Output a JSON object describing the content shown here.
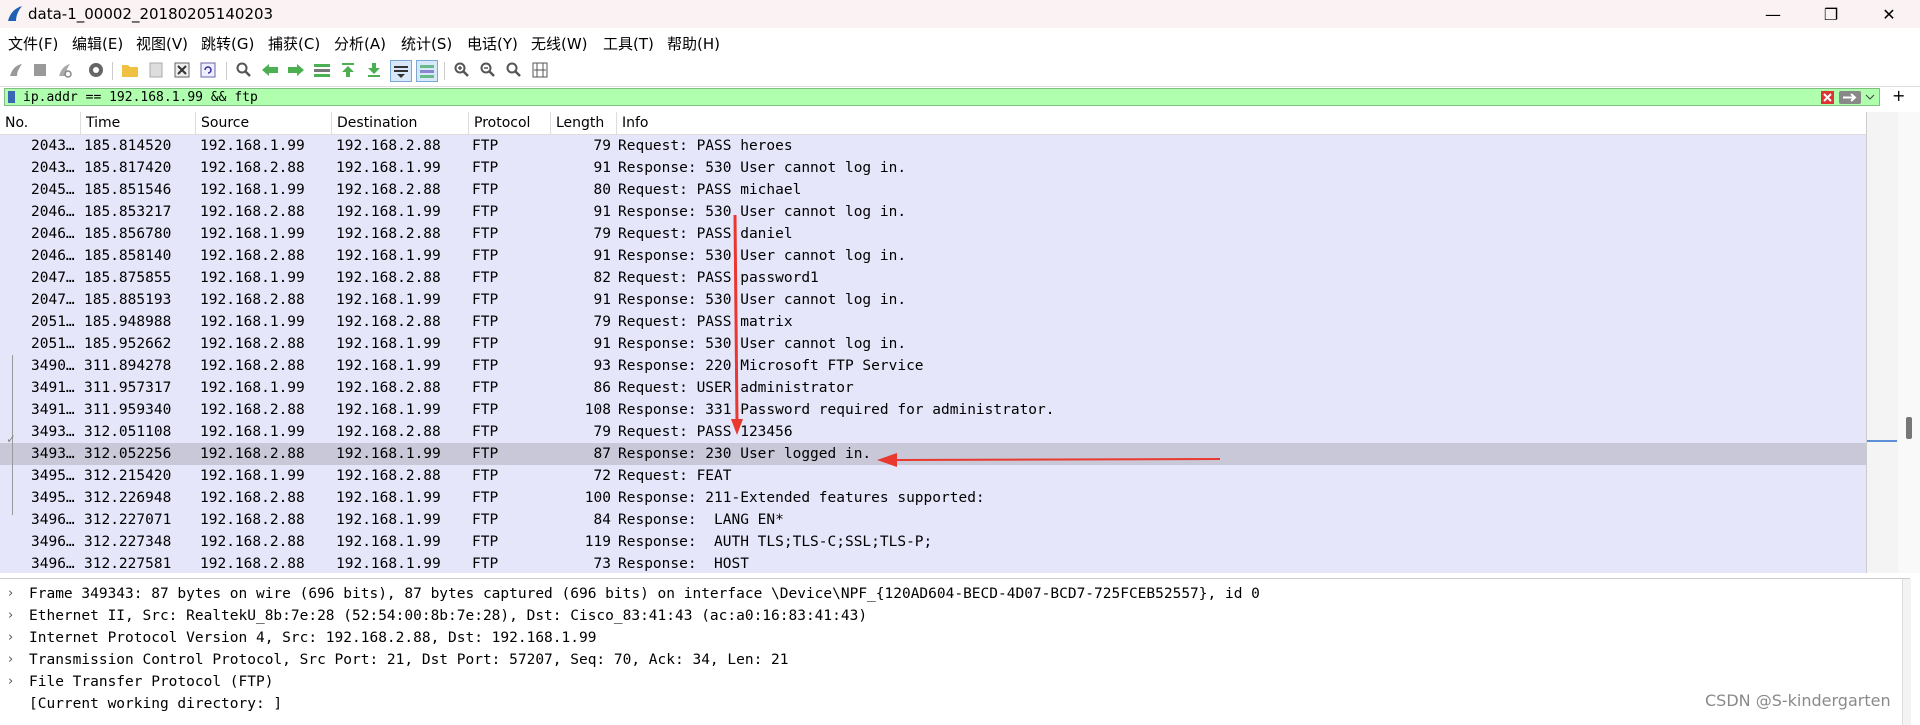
{
  "window": {
    "title": "data-1_00002_20180205140203",
    "minimize": "—",
    "maximize": "❐",
    "close": "✕"
  },
  "menu": [
    "文件(F)",
    "编辑(E)",
    "视图(V)",
    "跳转(G)",
    "捕获(C)",
    "分析(A)",
    "统计(S)",
    "电话(Y)",
    "无线(W)",
    "工具(T)",
    "帮助(H)"
  ],
  "filter": {
    "value": "ip.addr == 192.168.1.99 && ftp",
    "add_label": "+"
  },
  "columns": [
    "No.",
    "Time",
    "Source",
    "Destination",
    "Protocol",
    "Length",
    "Info"
  ],
  "packets": [
    {
      "no": "2043…",
      "time": "185.814520",
      "src": "192.168.1.99",
      "dst": "192.168.2.88",
      "proto": "FTP",
      "len": "79",
      "info": "Request: PASS heroes"
    },
    {
      "no": "2043…",
      "time": "185.817420",
      "src": "192.168.2.88",
      "dst": "192.168.1.99",
      "proto": "FTP",
      "len": "91",
      "info": "Response: 530 User cannot log in."
    },
    {
      "no": "2045…",
      "time": "185.851546",
      "src": "192.168.1.99",
      "dst": "192.168.2.88",
      "proto": "FTP",
      "len": "80",
      "info": "Request: PASS michael"
    },
    {
      "no": "2046…",
      "time": "185.853217",
      "src": "192.168.2.88",
      "dst": "192.168.1.99",
      "proto": "FTP",
      "len": "91",
      "info": "Response: 530 User cannot log in."
    },
    {
      "no": "2046…",
      "time": "185.856780",
      "src": "192.168.1.99",
      "dst": "192.168.2.88",
      "proto": "FTP",
      "len": "79",
      "info": "Request: PASS daniel"
    },
    {
      "no": "2046…",
      "time": "185.858140",
      "src": "192.168.2.88",
      "dst": "192.168.1.99",
      "proto": "FTP",
      "len": "91",
      "info": "Response: 530 User cannot log in."
    },
    {
      "no": "2047…",
      "time": "185.875855",
      "src": "192.168.1.99",
      "dst": "192.168.2.88",
      "proto": "FTP",
      "len": "82",
      "info": "Request: PASS password1"
    },
    {
      "no": "2047…",
      "time": "185.885193",
      "src": "192.168.2.88",
      "dst": "192.168.1.99",
      "proto": "FTP",
      "len": "91",
      "info": "Response: 530 User cannot log in."
    },
    {
      "no": "2051…",
      "time": "185.948988",
      "src": "192.168.1.99",
      "dst": "192.168.2.88",
      "proto": "FTP",
      "len": "79",
      "info": "Request: PASS matrix"
    },
    {
      "no": "2051…",
      "time": "185.952662",
      "src": "192.168.2.88",
      "dst": "192.168.1.99",
      "proto": "FTP",
      "len": "91",
      "info": "Response: 530 User cannot log in."
    },
    {
      "no": "3490…",
      "time": "311.894278",
      "src": "192.168.2.88",
      "dst": "192.168.1.99",
      "proto": "FTP",
      "len": "93",
      "info": "Response: 220 Microsoft FTP Service"
    },
    {
      "no": "3491…",
      "time": "311.957317",
      "src": "192.168.1.99",
      "dst": "192.168.2.88",
      "proto": "FTP",
      "len": "86",
      "info": "Request: USER administrator"
    },
    {
      "no": "3491…",
      "time": "311.959340",
      "src": "192.168.2.88",
      "dst": "192.168.1.99",
      "proto": "FTP",
      "len": "108",
      "info": "Response: 331 Password required for administrator."
    },
    {
      "no": "3493…",
      "time": "312.051108",
      "src": "192.168.1.99",
      "dst": "192.168.2.88",
      "proto": "FTP",
      "len": "79",
      "info": "Request: PASS 123456"
    },
    {
      "no": "3493…",
      "time": "312.052256",
      "src": "192.168.2.88",
      "dst": "192.168.1.99",
      "proto": "FTP",
      "len": "87",
      "info": "Response: 230 User logged in.",
      "selected": true
    },
    {
      "no": "3495…",
      "time": "312.215420",
      "src": "192.168.1.99",
      "dst": "192.168.2.88",
      "proto": "FTP",
      "len": "72",
      "info": "Request: FEAT"
    },
    {
      "no": "3495…",
      "time": "312.226948",
      "src": "192.168.2.88",
      "dst": "192.168.1.99",
      "proto": "FTP",
      "len": "100",
      "info": "Response: 211-Extended features supported:"
    },
    {
      "no": "3496…",
      "time": "312.227071",
      "src": "192.168.2.88",
      "dst": "192.168.1.99",
      "proto": "FTP",
      "len": "84",
      "info": "Response:  LANG EN*"
    },
    {
      "no": "3496…",
      "time": "312.227348",
      "src": "192.168.2.88",
      "dst": "192.168.1.99",
      "proto": "FTP",
      "len": "119",
      "info": "Response:  AUTH TLS;TLS-C;SSL;TLS-P;"
    },
    {
      "no": "3496…",
      "time": "312.227581",
      "src": "192.168.2.88",
      "dst": "192.168.1.99",
      "proto": "FTP",
      "len": "73",
      "info": "Response:  HOST"
    }
  ],
  "details": [
    {
      "text": "Frame 349343: 87 bytes on wire (696 bits), 87 bytes captured (696 bits) on interface \\Device\\NPF_{120AD604-BECD-4D07-BCD7-725FCEB52557}, id 0",
      "expandable": true
    },
    {
      "text": "Ethernet II, Src: RealtekU_8b:7e:28 (52:54:00:8b:7e:28), Dst: Cisco_83:41:43 (ac:a0:16:83:41:43)",
      "expandable": true
    },
    {
      "text": "Internet Protocol Version 4, Src: 192.168.2.88, Dst: 192.168.1.99",
      "expandable": true
    },
    {
      "text": "Transmission Control Protocol, Src Port: 21, Dst Port: 57207, Seq: 70, Ack: 34, Len: 21",
      "expandable": true
    },
    {
      "text": "File Transfer Protocol (FTP)",
      "expandable": true
    },
    {
      "text": "[Current working directory: ]",
      "expandable": false
    }
  ],
  "watermark": "CSDN @S-kindergarten",
  "colors": {
    "filter_bg": "#afffaf",
    "row_bg": "#e6e6fa",
    "selected_bg": "#c8c8d8",
    "annotation": "#e8382f"
  }
}
